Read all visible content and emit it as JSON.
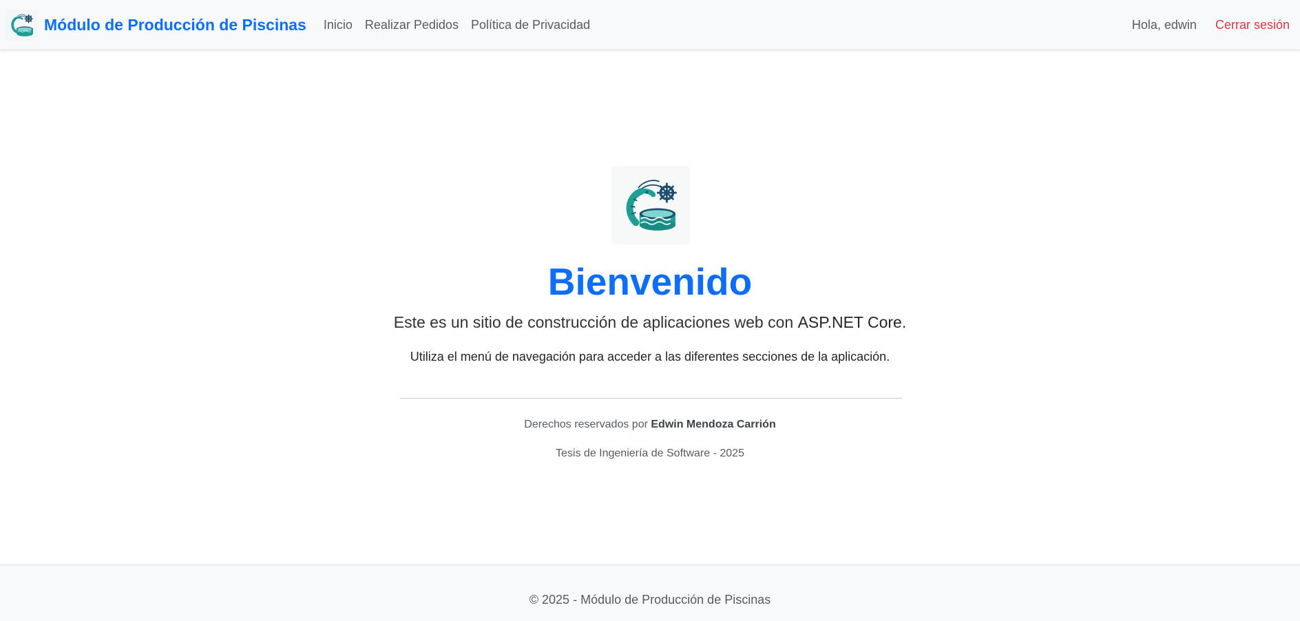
{
  "navbar": {
    "brand_title": "Módulo de Producción de Piscinas",
    "brand_logo_icon": "shrimp-pool-logo-icon",
    "links": [
      {
        "label": "Inicio"
      },
      {
        "label": "Realizar Pedidos"
      },
      {
        "label": "Política de Privacidad"
      }
    ],
    "greeting": "Hola, edwin",
    "logout_label": "Cerrar sesión"
  },
  "main": {
    "hero_icon": "shrimp-pool-logo-icon",
    "title": "Bienvenido",
    "lead_prefix": "Este es un sitio de construcción de aplicaciones web con ",
    "lead_strong": "ASP.NET Core",
    "lead_suffix": ".",
    "help_text": "Utiliza el menú de navegación para acceder a las diferentes secciones de la aplicación.",
    "rights_prefix": "Derechos reservados por ",
    "rights_author": "Edwin Mendoza Carrión",
    "thesis": "Tesis de Ingeniería de Software - 2025"
  },
  "footer": {
    "text": "© 2025 - Módulo de Producción de Piscinas"
  },
  "colors": {
    "primary": "#0d6efd",
    "danger": "#dc3545",
    "navbar_bg": "#f8f9fa",
    "teal": "#1f9e96",
    "navy": "#1d4e6b"
  }
}
